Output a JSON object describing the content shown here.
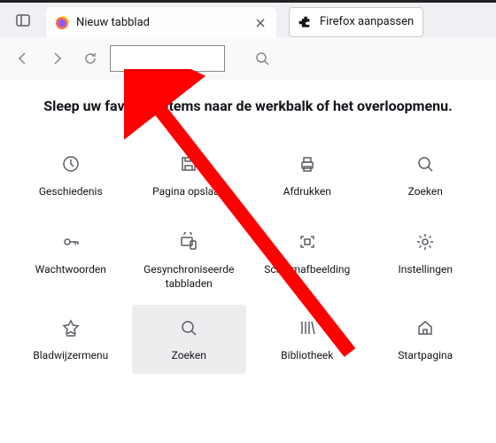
{
  "tab": {
    "title": "Nieuw tabblad"
  },
  "customize": {
    "label": "Firefox aanpassen"
  },
  "instruction": "Sleep uw favoriete items naar de werkbalk of het overloopmenu.",
  "items": [
    {
      "label": "Geschiedenis",
      "icon": "history"
    },
    {
      "label": "Pagina opslaan",
      "icon": "save"
    },
    {
      "label": "Afdrukken",
      "icon": "print"
    },
    {
      "label": "Zoeken",
      "icon": "search"
    },
    {
      "label": "Wachtwoorden",
      "icon": "key"
    },
    {
      "label": "Gesynchroniseerde tabbladen",
      "icon": "synctabs"
    },
    {
      "label": "Schermafbeelding",
      "icon": "screenshot"
    },
    {
      "label": "Instellingen",
      "icon": "settings"
    },
    {
      "label": "Bladwijzermenu",
      "icon": "bookmarkmenu"
    },
    {
      "label": "Zoeken",
      "icon": "search",
      "highlighted": true
    },
    {
      "label": "Bibliotheek",
      "icon": "library"
    },
    {
      "label": "Startpagina",
      "icon": "home"
    }
  ]
}
